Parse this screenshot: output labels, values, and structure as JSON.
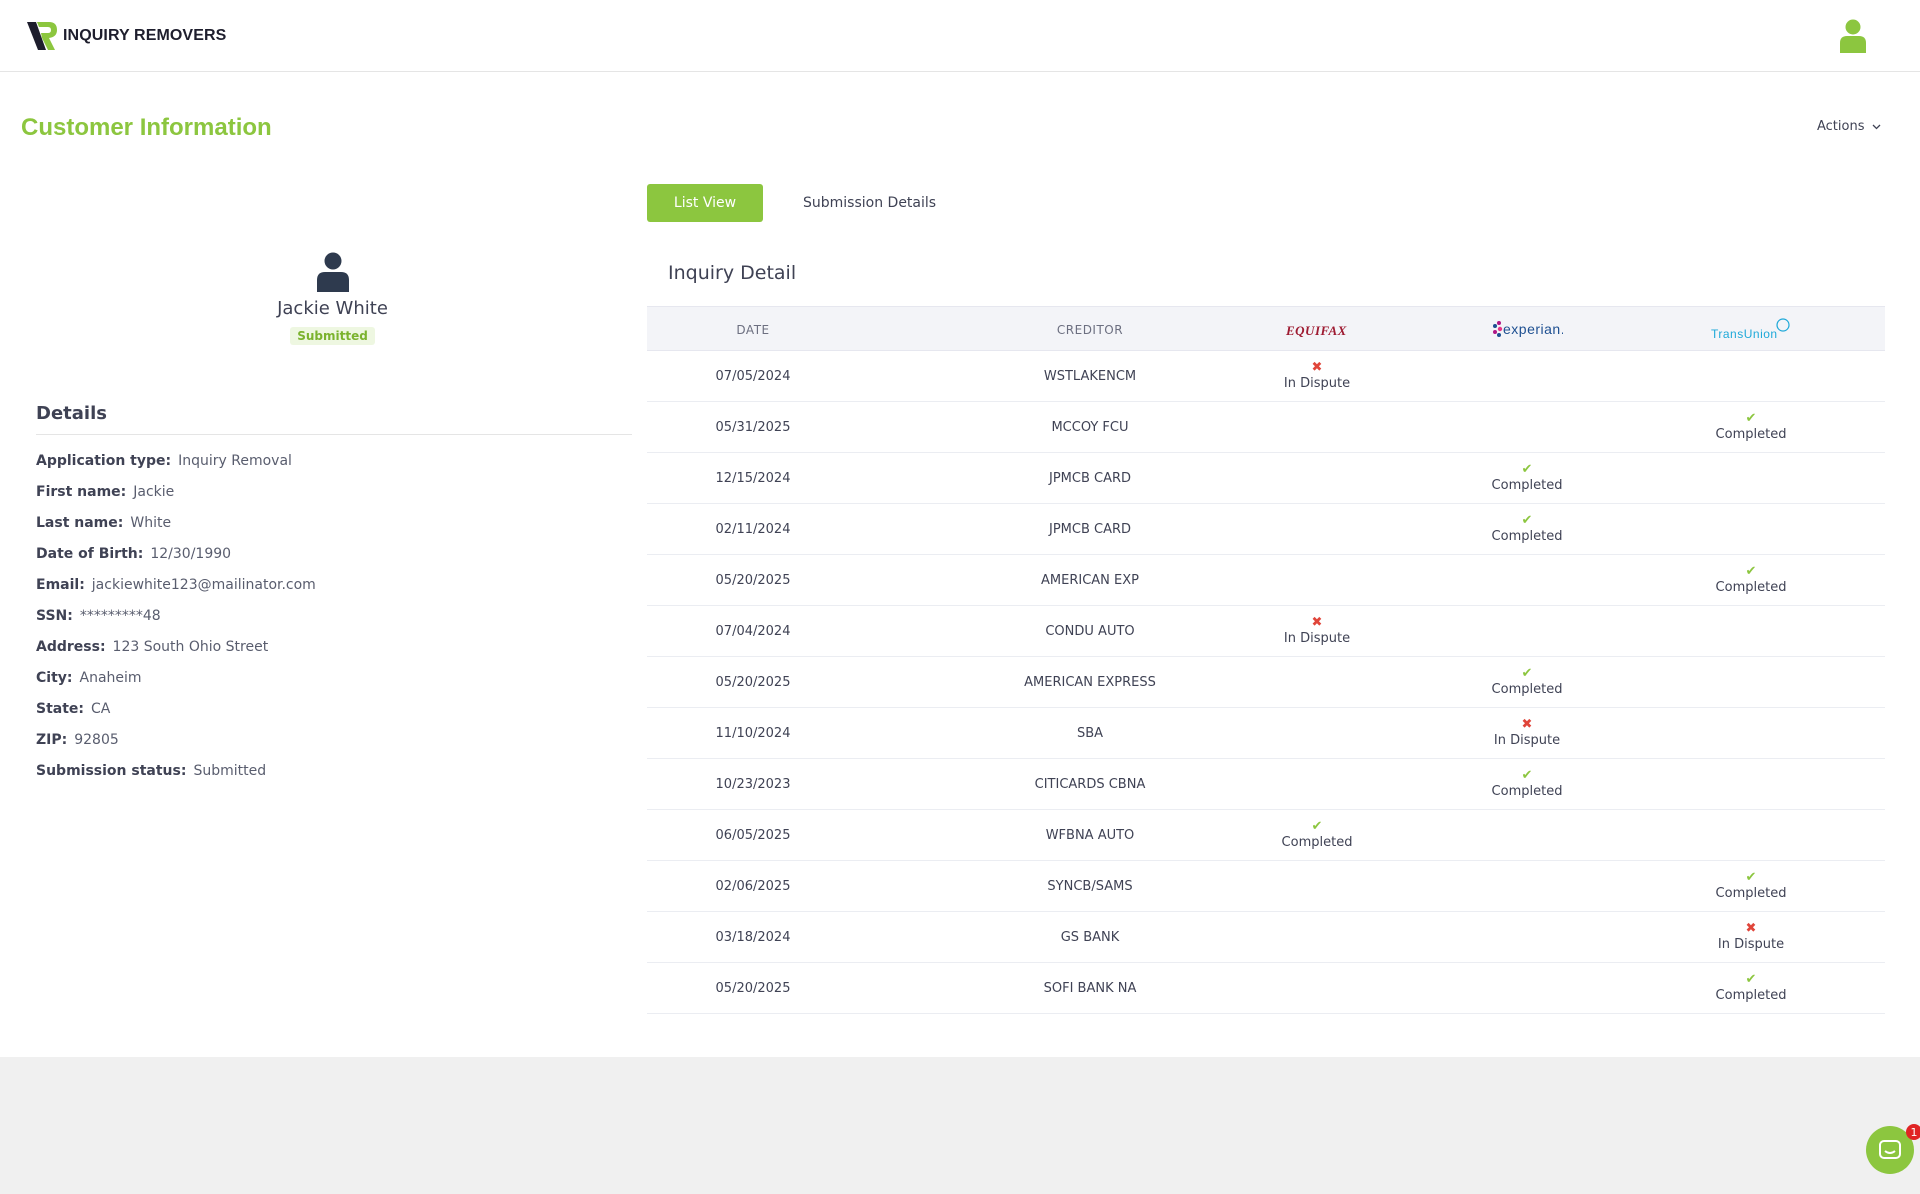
{
  "header": {
    "brand_name": "INQUIRY REMOVERS",
    "brand_color": "#8cc63f"
  },
  "page": {
    "title": "Customer Information",
    "actions_label": "Actions"
  },
  "profile": {
    "name": "Jackie White",
    "status_badge": "Submitted"
  },
  "details": {
    "title": "Details",
    "rows": [
      {
        "label": "Application type:",
        "value": "Inquiry Removal"
      },
      {
        "label": "First name:",
        "value": "Jackie"
      },
      {
        "label": "Last name:",
        "value": "White"
      },
      {
        "label": "Date of Birth:",
        "value": "12/30/1990"
      },
      {
        "label": "Email:",
        "value": "jackiewhite123@mailinator.com"
      },
      {
        "label": "SSN:",
        "value": "*********48"
      },
      {
        "label": "Address:",
        "value": "123 South Ohio Street"
      },
      {
        "label": "City:",
        "value": "Anaheim"
      },
      {
        "label": "State:",
        "value": "CA"
      },
      {
        "label": "ZIP:",
        "value": "92805"
      },
      {
        "label": "Submission status:",
        "value": "Submitted"
      }
    ]
  },
  "tabs": {
    "list_view": "List View",
    "submission_details": "Submission Details"
  },
  "inquiry": {
    "title": "Inquiry Detail",
    "columns": {
      "date": "DATE",
      "creditor": "CREDITOR",
      "equifax": "EQUIFAX",
      "experian": "experian.",
      "transunion": "TransUnion"
    },
    "rows": [
      {
        "date": "07/05/2024",
        "creditor": "WSTLAKENCM",
        "equifax": "In Dispute",
        "experian": "",
        "transunion": ""
      },
      {
        "date": "05/31/2025",
        "creditor": "MCCOY FCU",
        "equifax": "",
        "experian": "",
        "transunion": "Completed"
      },
      {
        "date": "12/15/2024",
        "creditor": "JPMCB CARD",
        "equifax": "",
        "experian": "Completed",
        "transunion": ""
      },
      {
        "date": "02/11/2024",
        "creditor": "JPMCB CARD",
        "equifax": "",
        "experian": "Completed",
        "transunion": ""
      },
      {
        "date": "05/20/2025",
        "creditor": "AMERICAN EXP",
        "equifax": "",
        "experian": "",
        "transunion": "Completed"
      },
      {
        "date": "07/04/2024",
        "creditor": "CONDU AUTO",
        "equifax": "In Dispute",
        "experian": "",
        "transunion": ""
      },
      {
        "date": "05/20/2025",
        "creditor": "AMERICAN EXPRESS",
        "equifax": "",
        "experian": "Completed",
        "transunion": ""
      },
      {
        "date": "11/10/2024",
        "creditor": "SBA",
        "equifax": "",
        "experian": "In Dispute",
        "transunion": ""
      },
      {
        "date": "10/23/2023",
        "creditor": "CITICARDS CBNA",
        "equifax": "",
        "experian": "Completed",
        "transunion": ""
      },
      {
        "date": "06/05/2025",
        "creditor": "WFBNA AUTO",
        "equifax": "Completed",
        "experian": "",
        "transunion": ""
      },
      {
        "date": "02/06/2025",
        "creditor": "SYNCB/SAMS",
        "equifax": "",
        "experian": "",
        "transunion": "Completed"
      },
      {
        "date": "03/18/2024",
        "creditor": "GS BANK",
        "equifax": "",
        "experian": "",
        "transunion": "In Dispute"
      },
      {
        "date": "05/20/2025",
        "creditor": "SOFI BANK NA",
        "equifax": "",
        "experian": "",
        "transunion": "Completed"
      }
    ]
  },
  "chat": {
    "unread_count": "1"
  }
}
